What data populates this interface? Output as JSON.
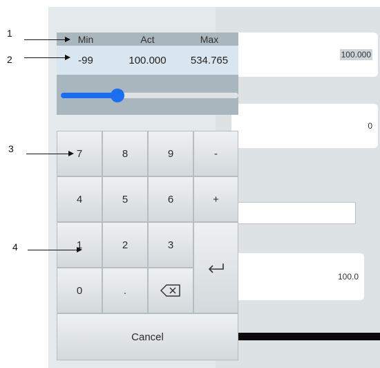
{
  "header": {
    "min_label": "Min",
    "act_label": "Act",
    "max_label": "Max"
  },
  "values": {
    "min": "-99",
    "act": "100.000",
    "max": "534.765"
  },
  "slider": {
    "level_fraction": 0.32,
    "accent": "#1a6ff0"
  },
  "keypad": {
    "keys": [
      "7",
      "8",
      "9",
      "-",
      "4",
      "5",
      "6",
      "+",
      "1",
      "2",
      "3",
      "0",
      ".",
      ""
    ],
    "backspace_icon": "backspace-icon",
    "enter_icon": "enter-icon",
    "cancel_label": "Cancel"
  },
  "fields": {
    "field1_value": "100.000",
    "field2_value": "0",
    "field3_value": "",
    "field4_value": "100.0"
  },
  "annotations": [
    "1",
    "2",
    "3",
    "4"
  ]
}
